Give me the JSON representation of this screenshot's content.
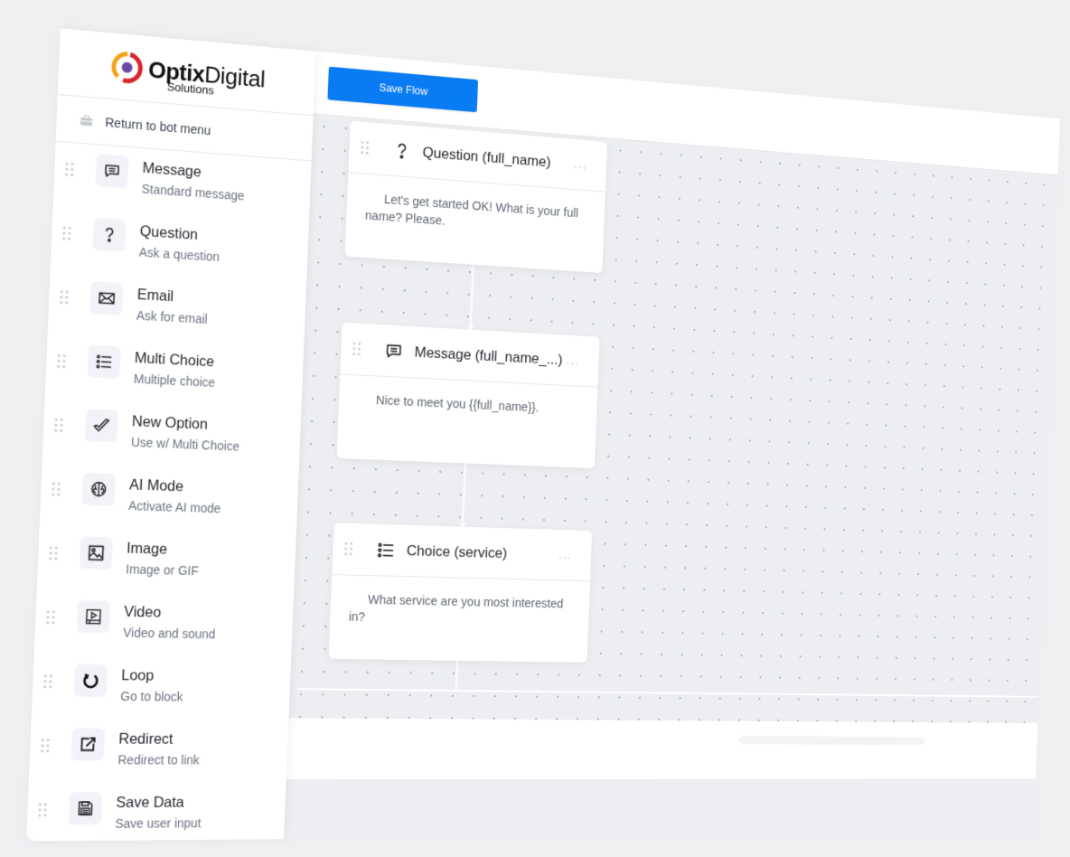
{
  "brand": {
    "name_bold": "Optix",
    "name_regular": "Digital",
    "tagline": "Solutions",
    "colors": {
      "ring_orange": "#f2a51c",
      "ring_red": "#d9262c",
      "core_purple": "#6a4aa3"
    }
  },
  "sidebar": {
    "return_link": {
      "label": "Return to bot menu",
      "icon": "briefcase-icon"
    },
    "blocks": [
      {
        "title": "Message",
        "subtitle": "Standard message",
        "icon": "chat-bubble-icon"
      },
      {
        "title": "Question",
        "subtitle": "Ask a question",
        "icon": "question-mark-icon"
      },
      {
        "title": "Email",
        "subtitle": "Ask for email",
        "icon": "envelope-icon"
      },
      {
        "title": "Multi Choice",
        "subtitle": "Multiple choice",
        "icon": "list-icon"
      },
      {
        "title": "New Option",
        "subtitle": "Use w/ Multi Choice",
        "icon": "double-check-icon"
      },
      {
        "title": "AI Mode",
        "subtitle": "Activate AI mode",
        "icon": "brain-icon"
      },
      {
        "title": "Image",
        "subtitle": "Image or GIF",
        "icon": "image-icon"
      },
      {
        "title": "Video",
        "subtitle": "Video and sound",
        "icon": "video-icon"
      },
      {
        "title": "Loop",
        "subtitle": "Go to block",
        "icon": "loop-icon"
      },
      {
        "title": "Redirect",
        "subtitle": "Redirect to link",
        "icon": "external-link-icon"
      },
      {
        "title": "Save Data",
        "subtitle": "Save user input",
        "icon": "floppy-disk-icon"
      }
    ]
  },
  "toolbar": {
    "save_label": "Save Flow",
    "accent": "#0a7cf3"
  },
  "flow": {
    "nodes": [
      {
        "title": "Question (full_name)",
        "body": "Let's get started OK! What is your full name? Please.",
        "icon": "question-mark-icon",
        "menu": "···"
      },
      {
        "title": "Message (full_name_...)",
        "body": "Nice to meet you {{full_name}}.",
        "icon": "chat-bubble-icon",
        "menu": "···"
      },
      {
        "title": "Choice (service)",
        "body": "What service are you most interested in?",
        "icon": "list-icon",
        "menu": "···"
      }
    ]
  }
}
